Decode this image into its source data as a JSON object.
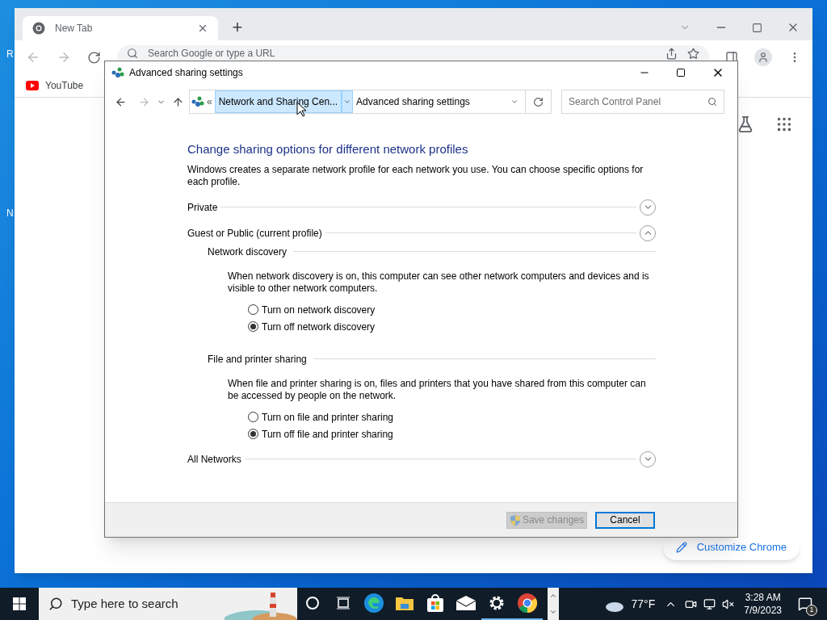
{
  "desktop": {
    "icon_labels": [
      "R",
      "N"
    ]
  },
  "browser": {
    "tabs": [
      {
        "title": "New Tab",
        "selected": true
      }
    ],
    "new_tab": "+",
    "omnibox": {
      "placeholder": "Search Google or type a URL"
    },
    "bookmarks": [
      {
        "label": "YouTube"
      }
    ],
    "customize_button": "Customize Chrome"
  },
  "dialog": {
    "title": "Advanced sharing settings",
    "breadcrumb": {
      "overflow": "«",
      "items": [
        {
          "label": "Network and Sharing Cen...",
          "selected": true
        },
        {
          "label": "Advanced sharing settings",
          "selected": false
        }
      ]
    },
    "search": {
      "placeholder": "Search Control Panel"
    },
    "heading": "Change sharing options for different network profiles",
    "description": "Windows creates a separate network profile for each network you use. You can choose specific options for each profile.",
    "profiles": [
      {
        "name": "Private",
        "expanded": false
      },
      {
        "name": "Guest or Public (current profile)",
        "expanded": true,
        "groups": [
          {
            "title": "Network discovery",
            "description": "When network discovery is on, this computer can see other network computers and devices and is visible to other network computers.",
            "options": [
              {
                "label": "Turn on network discovery",
                "selected": false
              },
              {
                "label": "Turn off network discovery",
                "selected": true
              }
            ]
          },
          {
            "title": "File and printer sharing",
            "description": "When file and printer sharing is on, files and printers that you have shared from this computer can be accessed by people on the network.",
            "options": [
              {
                "label": "Turn on file and printer sharing",
                "selected": false
              },
              {
                "label": "Turn off file and printer sharing",
                "selected": true
              }
            ]
          }
        ]
      },
      {
        "name": "All Networks",
        "expanded": false
      }
    ],
    "buttons": [
      {
        "label": "Save changes",
        "kind": "elevated",
        "disabled": true,
        "focused": false
      },
      {
        "label": "Cancel",
        "kind": "plain",
        "disabled": false,
        "focused": true
      }
    ]
  },
  "taskbar": {
    "search": {
      "placeholder": "Type here to search"
    },
    "apps": [
      {
        "kind": "cortana",
        "running": false
      },
      {
        "kind": "taskview",
        "running": false
      },
      {
        "kind": "edge",
        "running": false
      },
      {
        "kind": "explorer",
        "running": false
      },
      {
        "kind": "store",
        "running": false
      },
      {
        "kind": "mail",
        "running": false
      },
      {
        "kind": "settings",
        "running": true
      },
      {
        "kind": "chrome",
        "running": true
      }
    ],
    "weather": "77°F",
    "time": "3:28 AM",
    "date": "7/9/2023",
    "notifications": "1"
  }
}
